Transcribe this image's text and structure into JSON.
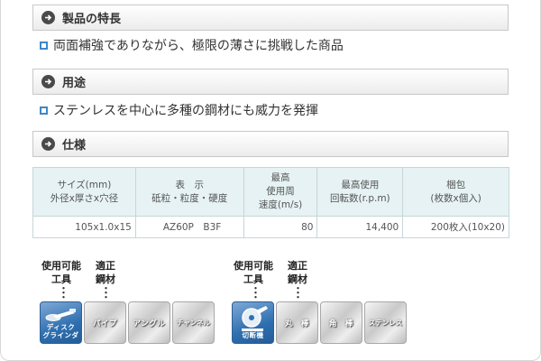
{
  "sections": {
    "features": {
      "title": "製品の特長",
      "text": "両面補強でありながら、極限の薄さに挑戦した商品"
    },
    "usage": {
      "title": "用途",
      "text": "ステンレスを中心に多種の鋼材にも威力を発揮"
    },
    "spec": {
      "title": "仕様"
    }
  },
  "spec_table": {
    "headers": [
      [
        "サイズ(mm)",
        "外径x厚さx穴径"
      ],
      [
        "表　示",
        "砥粒・粒度・硬度"
      ],
      [
        "最高",
        "使用周",
        "速度(m/s)"
      ],
      [
        "最高使用",
        "回転数(r.p.m)"
      ],
      [
        "梱包",
        "(枚数x個入)"
      ]
    ],
    "row": [
      "105x1.0x15",
      "AZ60P　B3F",
      "80",
      "14,400",
      "200枚入(10x20)"
    ]
  },
  "usage_groups": {
    "tool_label_1": "使用可能",
    "tool_label_2": "工具",
    "steel_label_1": "適正",
    "steel_label_2": "鋼材",
    "group1": {
      "tool": {
        "line1": "ディスク",
        "line2": "グラインダ",
        "icon": "disc-grinder-icon"
      },
      "steels": [
        "パイプ",
        "アングル",
        "チャンネル"
      ]
    },
    "group2": {
      "tool": {
        "line1": "切断機",
        "icon": "cutoff-machine-icon"
      },
      "steels": [
        "丸　棒",
        "角　棒",
        "ステンレス"
      ]
    }
  },
  "colors": {
    "accent_blue": "#3f86c8",
    "header_bg": "#e6f2f3",
    "tool_tile": "#2f6fb0"
  }
}
